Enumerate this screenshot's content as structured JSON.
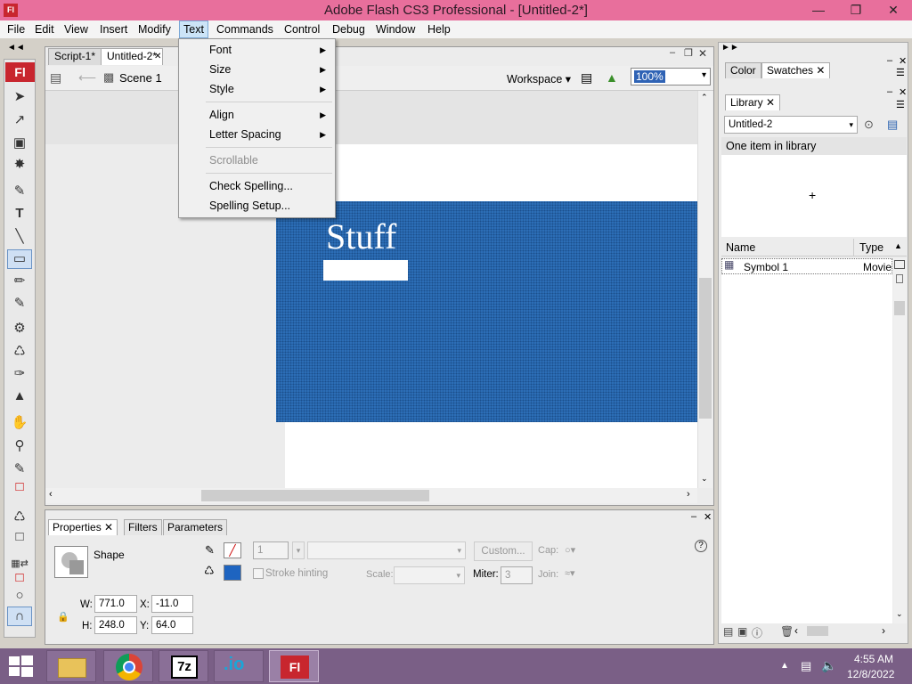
{
  "window": {
    "title": "Adobe Flash CS3 Professional - [Untitled-2*]",
    "app_icon": "Fl"
  },
  "menubar": [
    "File",
    "Edit",
    "View",
    "Insert",
    "Modify",
    "Text",
    "Commands",
    "Control",
    "Debug",
    "Window",
    "Help"
  ],
  "text_menu": {
    "items": [
      {
        "label": "Font",
        "submenu": true
      },
      {
        "label": "Size",
        "submenu": true
      },
      {
        "label": "Style",
        "submenu": true
      },
      {
        "label": "Align",
        "submenu": true
      },
      {
        "label": "Letter Spacing",
        "submenu": true
      },
      {
        "label": "Scrollable",
        "disabled": true
      },
      {
        "label": "Check Spelling..."
      },
      {
        "label": "Spelling Setup..."
      }
    ]
  },
  "doc_tabs": [
    "Script-1*",
    "Untitled-2*"
  ],
  "editbar": {
    "scene": "Scene 1",
    "workspace": "Workspace",
    "zoom": "100%"
  },
  "stage": {
    "text": "Stuff",
    "shape_color": "#2d6fb8"
  },
  "properties": {
    "tabs": [
      "Properties",
      "Filters",
      "Parameters"
    ],
    "selection": "Shape",
    "stroke_height": "1",
    "custom_button": "Custom...",
    "cap_label": "Cap:",
    "stroke_hinting": "Stroke hinting",
    "scale_label": "Scale:",
    "miter_label": "Miter:",
    "miter_value": "3",
    "join_label": "Join:",
    "w_label": "W:",
    "w": "771.0",
    "h_label": "H:",
    "h": "248.0",
    "x_label": "X:",
    "x": "-11.0",
    "y_label": "Y:",
    "y": "64.0",
    "help": "?"
  },
  "right_panels": {
    "tabs_top": [
      "Color",
      "Swatches"
    ],
    "library_tab": "Library",
    "library_doc": "Untitled-2",
    "library_status": "One item in library",
    "col_name": "Name",
    "col_type": "Type",
    "item_name": "Symbol 1",
    "item_type": "Movie"
  },
  "taskbar": {
    "time": "4:55 AM",
    "date": "12/8/2022"
  }
}
